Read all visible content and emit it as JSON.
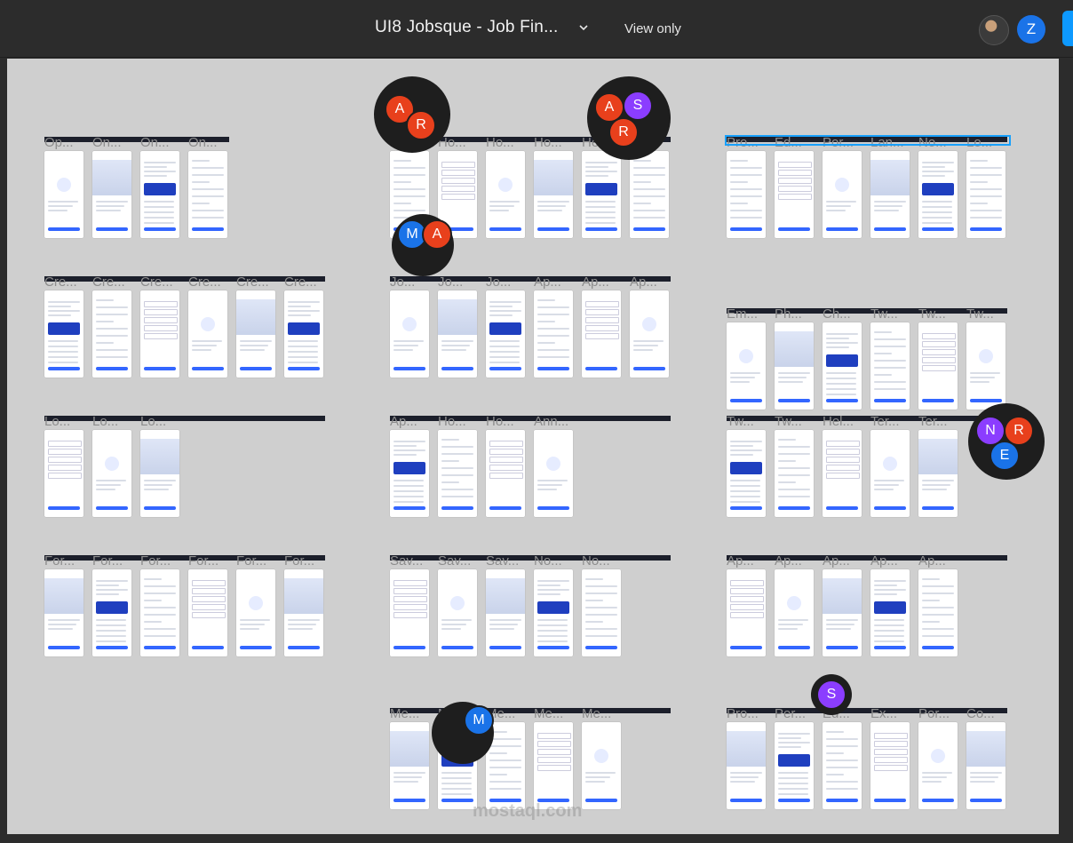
{
  "topbar": {
    "file_title": "UI8 Jobsque - Job Fin...",
    "view_mode": "View only",
    "user_initial": "Z"
  },
  "colors": {
    "canvas": "#cfcfcf",
    "toolbar": "#2c2c2c",
    "accent": "#3366ff",
    "selection": "#18a0fb"
  },
  "sections": [
    {
      "labels": [
        "Op...",
        "On...",
        "On...",
        "On..."
      ]
    },
    {
      "labels": [
        "Cre...",
        "Cre...",
        "Cre...",
        "Cre...",
        "Cre...",
        "Cre..."
      ]
    },
    {
      "labels": [
        "Lo...",
        "Lo...",
        "Lo..."
      ]
    },
    {
      "labels": [
        "For...",
        "For...",
        "For...",
        "For...",
        "For...",
        "For..."
      ]
    },
    {
      "labels": [
        "Jo...",
        "Ho...",
        "Ho...",
        "Ho...",
        "He...",
        ""
      ]
    },
    {
      "labels": [
        "Jo...",
        "Jo...",
        "Jo...",
        "Ap...",
        "Ap...",
        "Ap..."
      ]
    },
    {
      "labels": [
        "Ap...",
        "Ho...",
        "Ho...",
        "Ann..."
      ]
    },
    {
      "labels": [
        "Sav...",
        "Sav...",
        "Sav...",
        "No...",
        "No..."
      ]
    },
    {
      "labels": [
        "Me...",
        "Me...",
        "Me...",
        "Me...",
        "Me..."
      ]
    },
    {
      "labels": [
        "Pro...",
        "Ed...",
        "Por...",
        "Lan...",
        "No...",
        "Lo..."
      ]
    },
    {
      "labels": [
        "Em...",
        "Ph...",
        "Ch...",
        "Tw...",
        "Tw...",
        "Tw..."
      ]
    },
    {
      "labels": [
        "Tw...",
        "Tw...",
        "Hel...",
        "Ter...",
        "Ter..."
      ]
    },
    {
      "labels": [
        "Ap...",
        "Ap...",
        "Ap...",
        "Ap...",
        "Ap..."
      ]
    },
    {
      "labels": [
        "Pro...",
        "Per...",
        "Ed...",
        "Ex...",
        "Por...",
        "Co..."
      ]
    }
  ],
  "collaborators": {
    "group1": [
      "A",
      "R"
    ],
    "group2": [
      "A",
      "S",
      "R"
    ],
    "group3": [
      "M",
      "A"
    ],
    "group4": [
      "N",
      "R",
      "E"
    ],
    "group5": [
      "S"
    ],
    "group6": [
      "M"
    ]
  },
  "watermark": "mostaql.com"
}
